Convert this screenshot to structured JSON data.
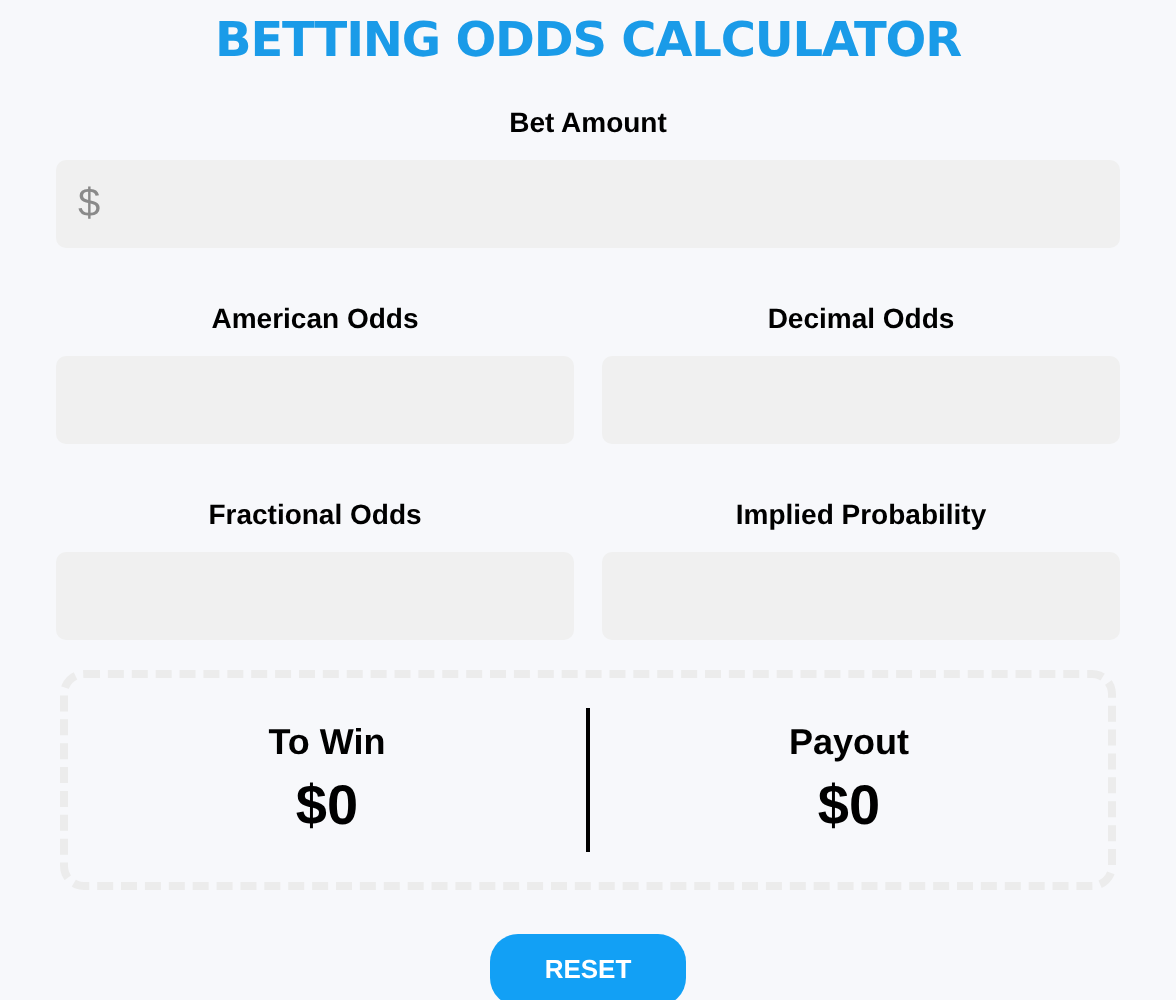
{
  "title": "BETTING ODDS CALCULATOR",
  "bet_amount": {
    "label": "Bet Amount",
    "prefix": "$"
  },
  "odds_fields": [
    {
      "label": "American Odds"
    },
    {
      "label": "Decimal Odds"
    },
    {
      "label": "Fractional Odds"
    },
    {
      "label": "Implied Probability"
    }
  ],
  "results": [
    {
      "label": "To Win",
      "value": "$0"
    },
    {
      "label": "Payout",
      "value": "$0"
    }
  ],
  "reset_button": "RESET"
}
